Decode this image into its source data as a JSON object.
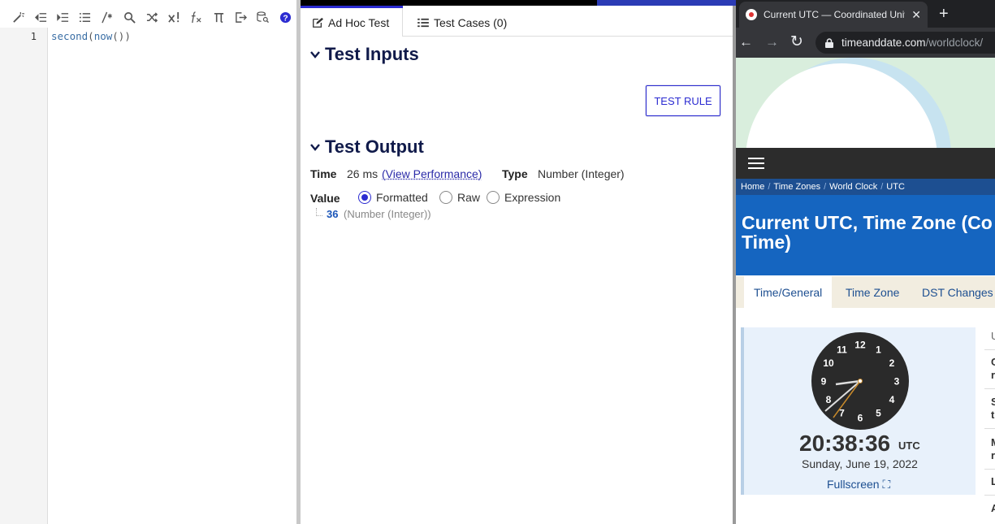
{
  "editor": {
    "toolbar": [
      "magic-wand-icon",
      "outdent-icon",
      "indent-icon",
      "list-icon",
      "comment-icon",
      "search-icon",
      "shuffle-icon",
      "x-factorial-icon",
      "fx-icon",
      "pi-icon",
      "export-icon",
      "database-search-icon",
      "help-icon"
    ],
    "line_number": "1",
    "code_fn_outer": "second",
    "code_open": "(",
    "code_fn_inner": "now",
    "code_close": "())"
  },
  "test_pane": {
    "tabs": {
      "adhoc": "Ad Hoc Test",
      "cases": "Test Cases (0)"
    },
    "test_inputs_title": "Test Inputs",
    "test_rule_button": "TEST RULE",
    "test_output_title": "Test Output",
    "time_label": "Time",
    "time_value": "26 ms",
    "view_performance": "(View Performance)",
    "type_label": "Type",
    "type_value": "Number (Integer)",
    "value_label": "Value",
    "radios": {
      "formatted": "Formatted",
      "raw": "Raw",
      "expression": "Expression",
      "selected": "formatted"
    },
    "result_number": "36",
    "result_type": "(Number (Integer))",
    "accent_color": "#2b2bd1"
  },
  "browser": {
    "tab_title": "Current UTC — Coordinated Univ",
    "tab_close": "✕",
    "new_tab": "+",
    "nav": {
      "back": "←",
      "forward": "→",
      "reload": "↻"
    },
    "url_host": "timeanddate.com",
    "url_path": "/worldclock/",
    "breadcrumb": [
      "Home",
      "Time Zones",
      "World Clock",
      "UTC"
    ],
    "breadcrumb_sep": "/",
    "headline_line1": "Current UTC, Time Zone (Co",
    "headline_line2": "Time)",
    "subtabs": [
      "Time/General",
      "Time Zone",
      "DST Changes"
    ],
    "clock_numbers": [
      "12",
      "1",
      "2",
      "3",
      "4",
      "5",
      "6",
      "7",
      "8",
      "9",
      "10",
      "11"
    ],
    "clock_time": "20:38:36",
    "clock_tz": "UTC",
    "clock_date": "Sunday, June 19, 2022",
    "fullscreen": "Fullscreen ⛶",
    "side_letters": [
      "U",
      "C",
      "r",
      "S",
      "t",
      "M",
      "r",
      "L",
      "A"
    ],
    "brand_color": "#1565c0"
  }
}
